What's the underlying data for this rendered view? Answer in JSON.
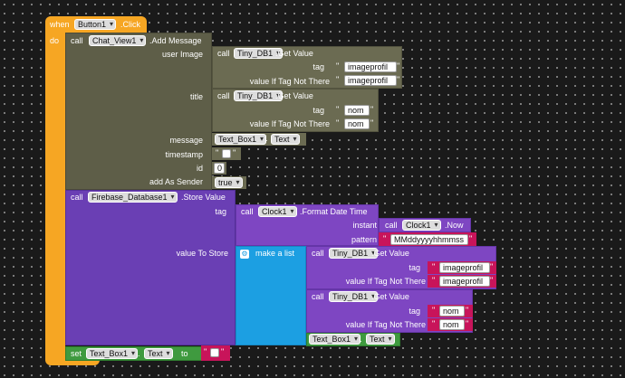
{
  "event": {
    "when": "when",
    "component": "Button1",
    "event_name": ".Click",
    "do": "do"
  },
  "call_kw": "call",
  "add_message": {
    "component": "Chat_View1",
    "method": ".Add Message",
    "user_image_label": "user Image",
    "title_label": "title",
    "message_label": "message",
    "timestamp_label": "timestamp",
    "id_label": "id",
    "add_as_sender_label": "add As Sender",
    "id_value": "0",
    "sender_value": "true"
  },
  "tinydb": {
    "component": "Tiny_DB1",
    "method": ".Get Value",
    "tag_label": "tag",
    "default_label": "value If Tag Not There",
    "tag_image": "imageprofil",
    "default_image": "imageprofil",
    "tag_nom": "nom",
    "default_nom": "nom"
  },
  "textbox": {
    "component": "Text_Box1",
    "property": "Text",
    "dot": "."
  },
  "firebase": {
    "component": "Firebase_Database1",
    "method": ".Store Value",
    "tag_label": "tag",
    "value_label": "value To Store"
  },
  "clock": {
    "component": "Clock1",
    "format_method": ".Format Date Time",
    "instant_label": "instant",
    "pattern_label": "pattern",
    "now_method": ".Now",
    "pattern_value": "MMddyyyyhhmmss"
  },
  "make_list": {
    "label": "make a list"
  },
  "set_block": {
    "set_kw": "set",
    "to_kw": "to",
    "empty_text": ""
  },
  "quote": "\"",
  "colors": {
    "event": "#f6a623",
    "chat_view": "#5e5e48",
    "tinydb": "#6b6b52",
    "firebase": "#6a3fb4",
    "clock": "#7e46c2",
    "list": "#1c9fe2",
    "textbox": "#3f9a3f",
    "text": "#c8145a",
    "logic": "#6b6b52"
  }
}
